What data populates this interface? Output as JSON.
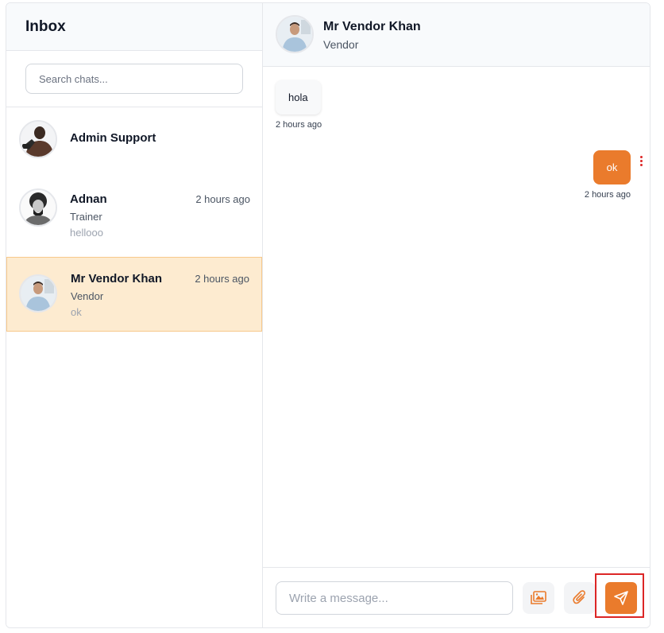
{
  "sidebar": {
    "title": "Inbox",
    "search_placeholder": "Search chats...",
    "chats": [
      {
        "name": "Admin Support",
        "role": "",
        "time": "",
        "last": "",
        "active": false
      },
      {
        "name": "Adnan",
        "role": "Trainer",
        "time": "2 hours ago",
        "last": "hellooo",
        "active": false
      },
      {
        "name": "Mr Vendor Khan",
        "role": "Vendor",
        "time": "2 hours ago",
        "last": "ok",
        "active": true
      }
    ]
  },
  "header": {
    "name": "Mr Vendor Khan",
    "role": "Vendor"
  },
  "messages": [
    {
      "direction": "incoming",
      "text": "hola",
      "time": "2 hours ago"
    },
    {
      "direction": "outgoing",
      "text": "ok",
      "time": "2 hours ago"
    }
  ],
  "composer": {
    "placeholder": "Write a message...",
    "image_icon": "image-icon",
    "attach_icon": "paperclip-icon",
    "send_icon": "send-icon"
  },
  "colors": {
    "accent": "#ea7b2c",
    "active_row": "#fdebd0",
    "highlight": "#dc2626"
  }
}
